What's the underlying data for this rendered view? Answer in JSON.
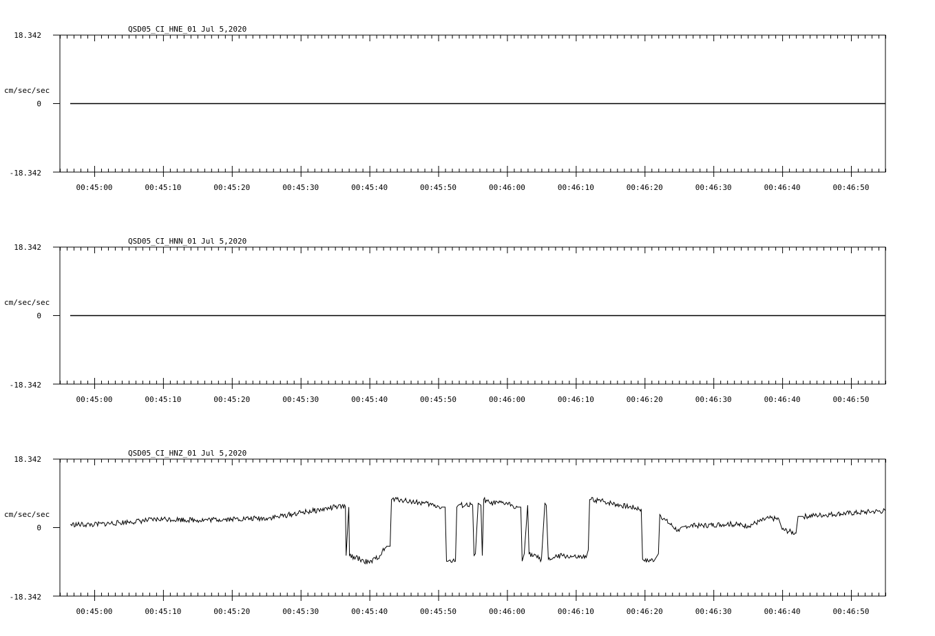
{
  "chart_data": [
    {
      "type": "line",
      "title": "QSD05_CI_HNE_01  Jul 5,2020",
      "ylabel": "cm/sec/sec",
      "ylim": [
        -18.342,
        18.342
      ],
      "ytick_labels": [
        "18.342",
        "0",
        "-18.342"
      ],
      "xlim_seconds": [
        -5,
        115
      ],
      "xticks_seconds": [
        0,
        10,
        20,
        30,
        40,
        50,
        60,
        70,
        80,
        90,
        100,
        110
      ],
      "xtick_labels": [
        "00:45:00",
        "00:45:10",
        "00:45:20",
        "00:45:30",
        "00:45:40",
        "00:45:50",
        "00:46:00",
        "00:46:10",
        "00:46:20",
        "00:46:30",
        "00:46:40",
        "00:46:50"
      ],
      "series": [
        {
          "x": [
            -3.5,
            115
          ],
          "y": [
            0,
            0
          ]
        }
      ]
    },
    {
      "type": "line",
      "title": "QSD05_CI_HNN_01  Jul 5,2020",
      "ylabel": "cm/sec/sec",
      "ylim": [
        -18.342,
        18.342
      ],
      "ytick_labels": [
        "18.342",
        "0",
        "-18.342"
      ],
      "xlim_seconds": [
        -5,
        115
      ],
      "xticks_seconds": [
        0,
        10,
        20,
        30,
        40,
        50,
        60,
        70,
        80,
        90,
        100,
        110
      ],
      "xtick_labels": [
        "00:45:00",
        "00:45:10",
        "00:45:20",
        "00:45:30",
        "00:45:40",
        "00:45:50",
        "00:46:00",
        "00:46:10",
        "00:46:20",
        "00:46:30",
        "00:46:40",
        "00:46:50"
      ],
      "series": [
        {
          "x": [
            -3.5,
            115
          ],
          "y": [
            0,
            0
          ]
        }
      ]
    },
    {
      "type": "line",
      "title": "QSD05_CI_HNZ_01  Jul 5,2020",
      "ylabel": "cm/sec/sec",
      "ylim": [
        -18.342,
        18.342
      ],
      "ytick_labels": [
        "18.342",
        "0",
        "-18.342"
      ],
      "xlim_seconds": [
        -5,
        115
      ],
      "xticks_seconds": [
        0,
        10,
        20,
        30,
        40,
        50,
        60,
        70,
        80,
        90,
        100,
        110
      ],
      "xtick_labels": [
        "00:45:00",
        "00:45:10",
        "00:45:20",
        "00:45:30",
        "00:45:40",
        "00:45:50",
        "00:46:00",
        "00:46:10",
        "00:46:20",
        "00:46:30",
        "00:46:40",
        "00:46:50"
      ],
      "series": [
        {
          "x": [
            -3.5,
            0,
            5,
            10,
            15,
            20,
            25,
            27,
            30,
            33,
            35,
            36.5,
            36.6,
            37,
            37.1,
            38,
            40,
            41.5,
            42.5,
            43,
            43.2,
            44.5,
            46,
            48,
            50.5,
            51,
            51.2,
            52.5,
            52.7,
            52.9,
            55,
            55.2,
            55.4,
            55.8,
            56.2,
            56.4,
            56.6,
            57.5,
            60,
            61.5,
            62,
            62.2,
            62.5,
            63,
            63.2,
            65,
            65.5,
            65.7,
            66,
            68,
            70,
            71.5,
            71.8,
            72,
            72.2,
            74,
            76.5,
            79.5,
            79.7,
            80,
            81.5,
            82,
            82.2,
            83,
            85,
            86,
            88,
            92,
            95,
            98,
            99.5,
            100,
            102,
            102.3,
            102.5,
            103,
            105,
            108,
            111,
            113,
            115
          ],
          "y": [
            0.8,
            0.8,
            1.5,
            2.3,
            2.0,
            2.3,
            2.5,
            3.0,
            4.0,
            4.8,
            5.5,
            5.6,
            -7.5,
            5.5,
            -7.5,
            -8.0,
            -9.5,
            -7.5,
            -5.0,
            -5.0,
            7.5,
            7.5,
            7.0,
            6.5,
            5.5,
            5.5,
            -9.0,
            -9.0,
            5.5,
            6.0,
            6.0,
            -7.5,
            -7.0,
            6.5,
            6.0,
            -7.5,
            7.5,
            6.5,
            6.5,
            5.5,
            5.5,
            -9.0,
            -7.0,
            6.0,
            -7.0,
            -8.5,
            6.5,
            6.0,
            -8.5,
            -7.5,
            -8.0,
            -8.0,
            -6.0,
            7.5,
            7.5,
            7.0,
            6.0,
            5.0,
            -8.5,
            -9.0,
            -8.5,
            -7.0,
            3.5,
            2.0,
            -1.0,
            0.5,
            0.5,
            1.0,
            0.5,
            2.5,
            2.3,
            -0.5,
            -1.5,
            3.0,
            3.0,
            3.0,
            3.3,
            3.7,
            4.0,
            4.3,
            4.5
          ]
        }
      ]
    }
  ]
}
